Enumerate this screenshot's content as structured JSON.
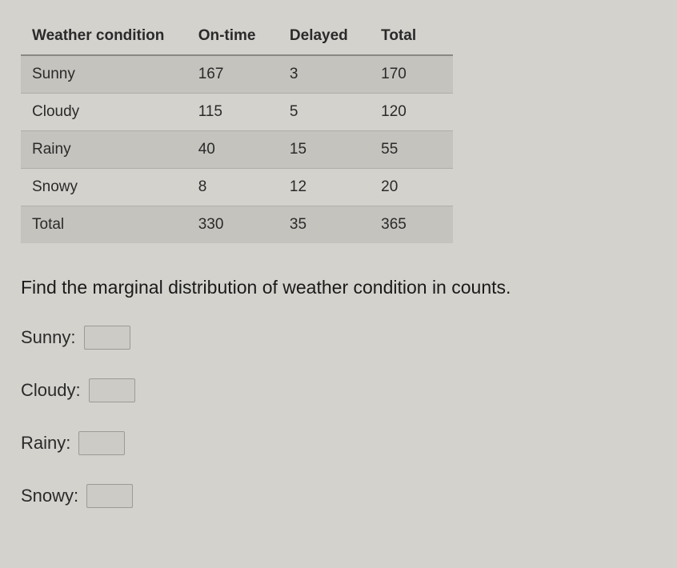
{
  "table": {
    "headers": [
      "Weather condition",
      "On-time",
      "Delayed",
      "Total"
    ],
    "rows": [
      {
        "label": "Sunny",
        "ontime": "167",
        "delayed": "3",
        "total": "170"
      },
      {
        "label": "Cloudy",
        "ontime": "115",
        "delayed": "5",
        "total": "120"
      },
      {
        "label": "Rainy",
        "ontime": "40",
        "delayed": "15",
        "total": "55"
      },
      {
        "label": "Snowy",
        "ontime": "8",
        "delayed": "12",
        "total": "20"
      },
      {
        "label": "Total",
        "ontime": "330",
        "delayed": "35",
        "total": "365"
      }
    ]
  },
  "question": "Find the marginal distribution of weather condition in counts.",
  "answers": {
    "items": [
      {
        "label": "Sunny:"
      },
      {
        "label": "Cloudy:"
      },
      {
        "label": "Rainy:"
      },
      {
        "label": "Snowy:"
      }
    ]
  }
}
